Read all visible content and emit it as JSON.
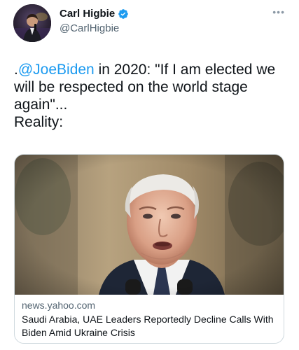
{
  "tweet": {
    "author": {
      "display_name": "Carl Higbie",
      "handle": "@CarlHigbie",
      "verified": true
    },
    "more_icon": "ellipsis-icon",
    "text": {
      "prefix": ".",
      "mention": "@JoeBiden",
      "rest": " in 2020: \"If I am elected we will be respected on the world stage again\"...",
      "line2": "Reality:"
    },
    "card": {
      "domain": "news.yahoo.com",
      "title": "Saudi Arabia, UAE Leaders Reportedly Decline Calls With Biden Amid Ukraine Crisis"
    }
  },
  "colors": {
    "link": "#1d9bf0",
    "verified": "#1d9bf0",
    "secondary_text": "#536471",
    "card_border": "#cfd9de"
  }
}
